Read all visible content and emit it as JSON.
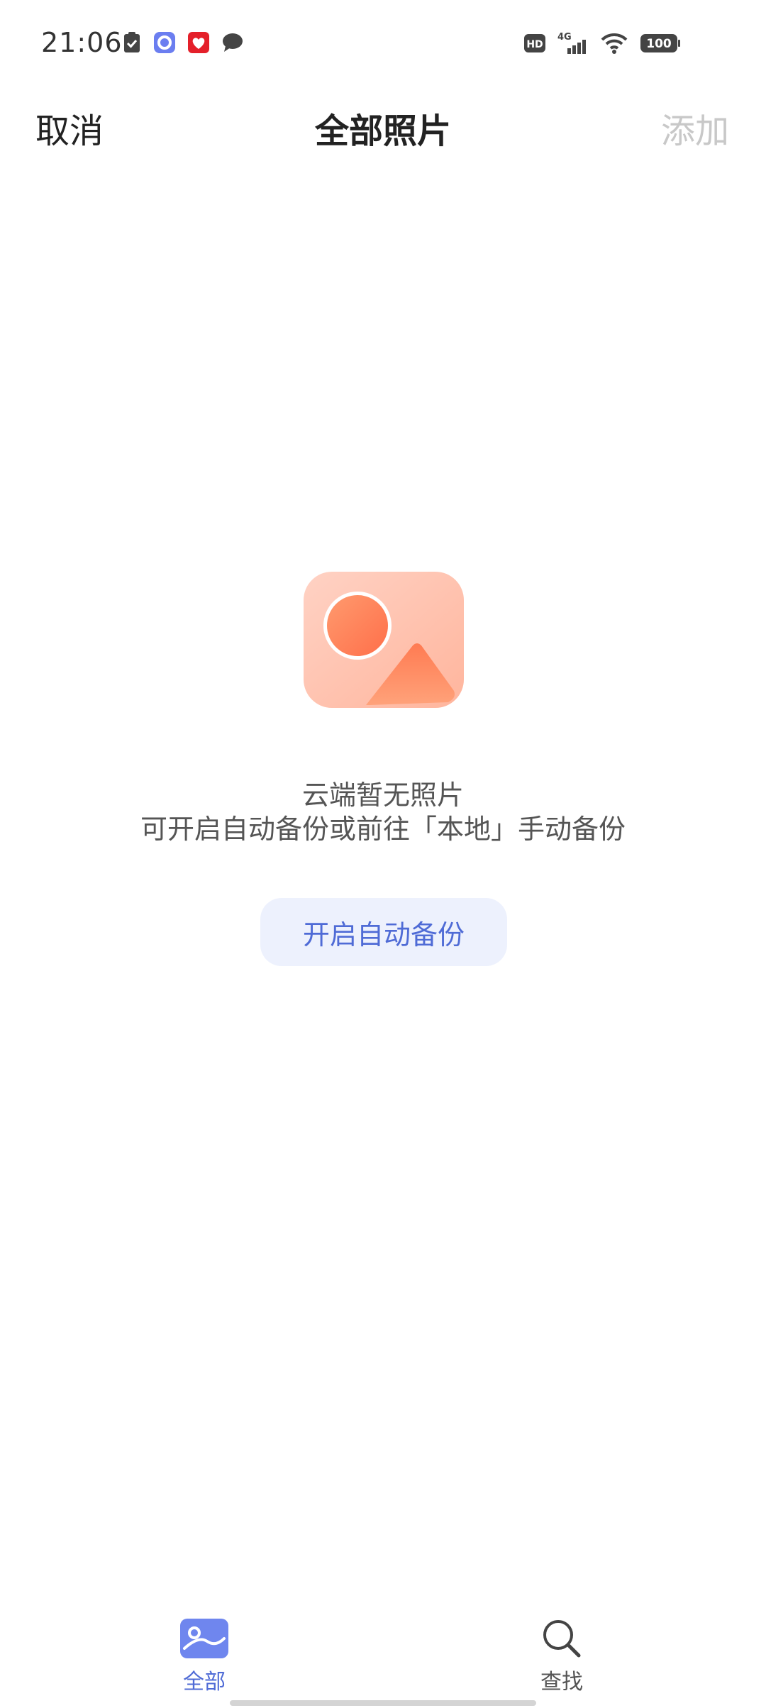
{
  "status_bar": {
    "time": "21:06",
    "network_label": "4G",
    "hd_label": "HD",
    "battery": "100"
  },
  "header": {
    "cancel": "取消",
    "title": "全部照片",
    "add": "添加"
  },
  "empty_state": {
    "title": "云端暂无照片",
    "description": "可开启自动备份或前往「本地」手动备份",
    "button": "开启自动备份"
  },
  "bottom_nav": {
    "items": [
      {
        "label": "全部",
        "icon": "gallery-icon",
        "active": true
      },
      {
        "label": "查找",
        "icon": "search-icon",
        "active": false
      }
    ]
  },
  "colors": {
    "accent": "#4f6bd6",
    "button_bg": "#edf1fd",
    "illustration": "#ff8a5c"
  }
}
